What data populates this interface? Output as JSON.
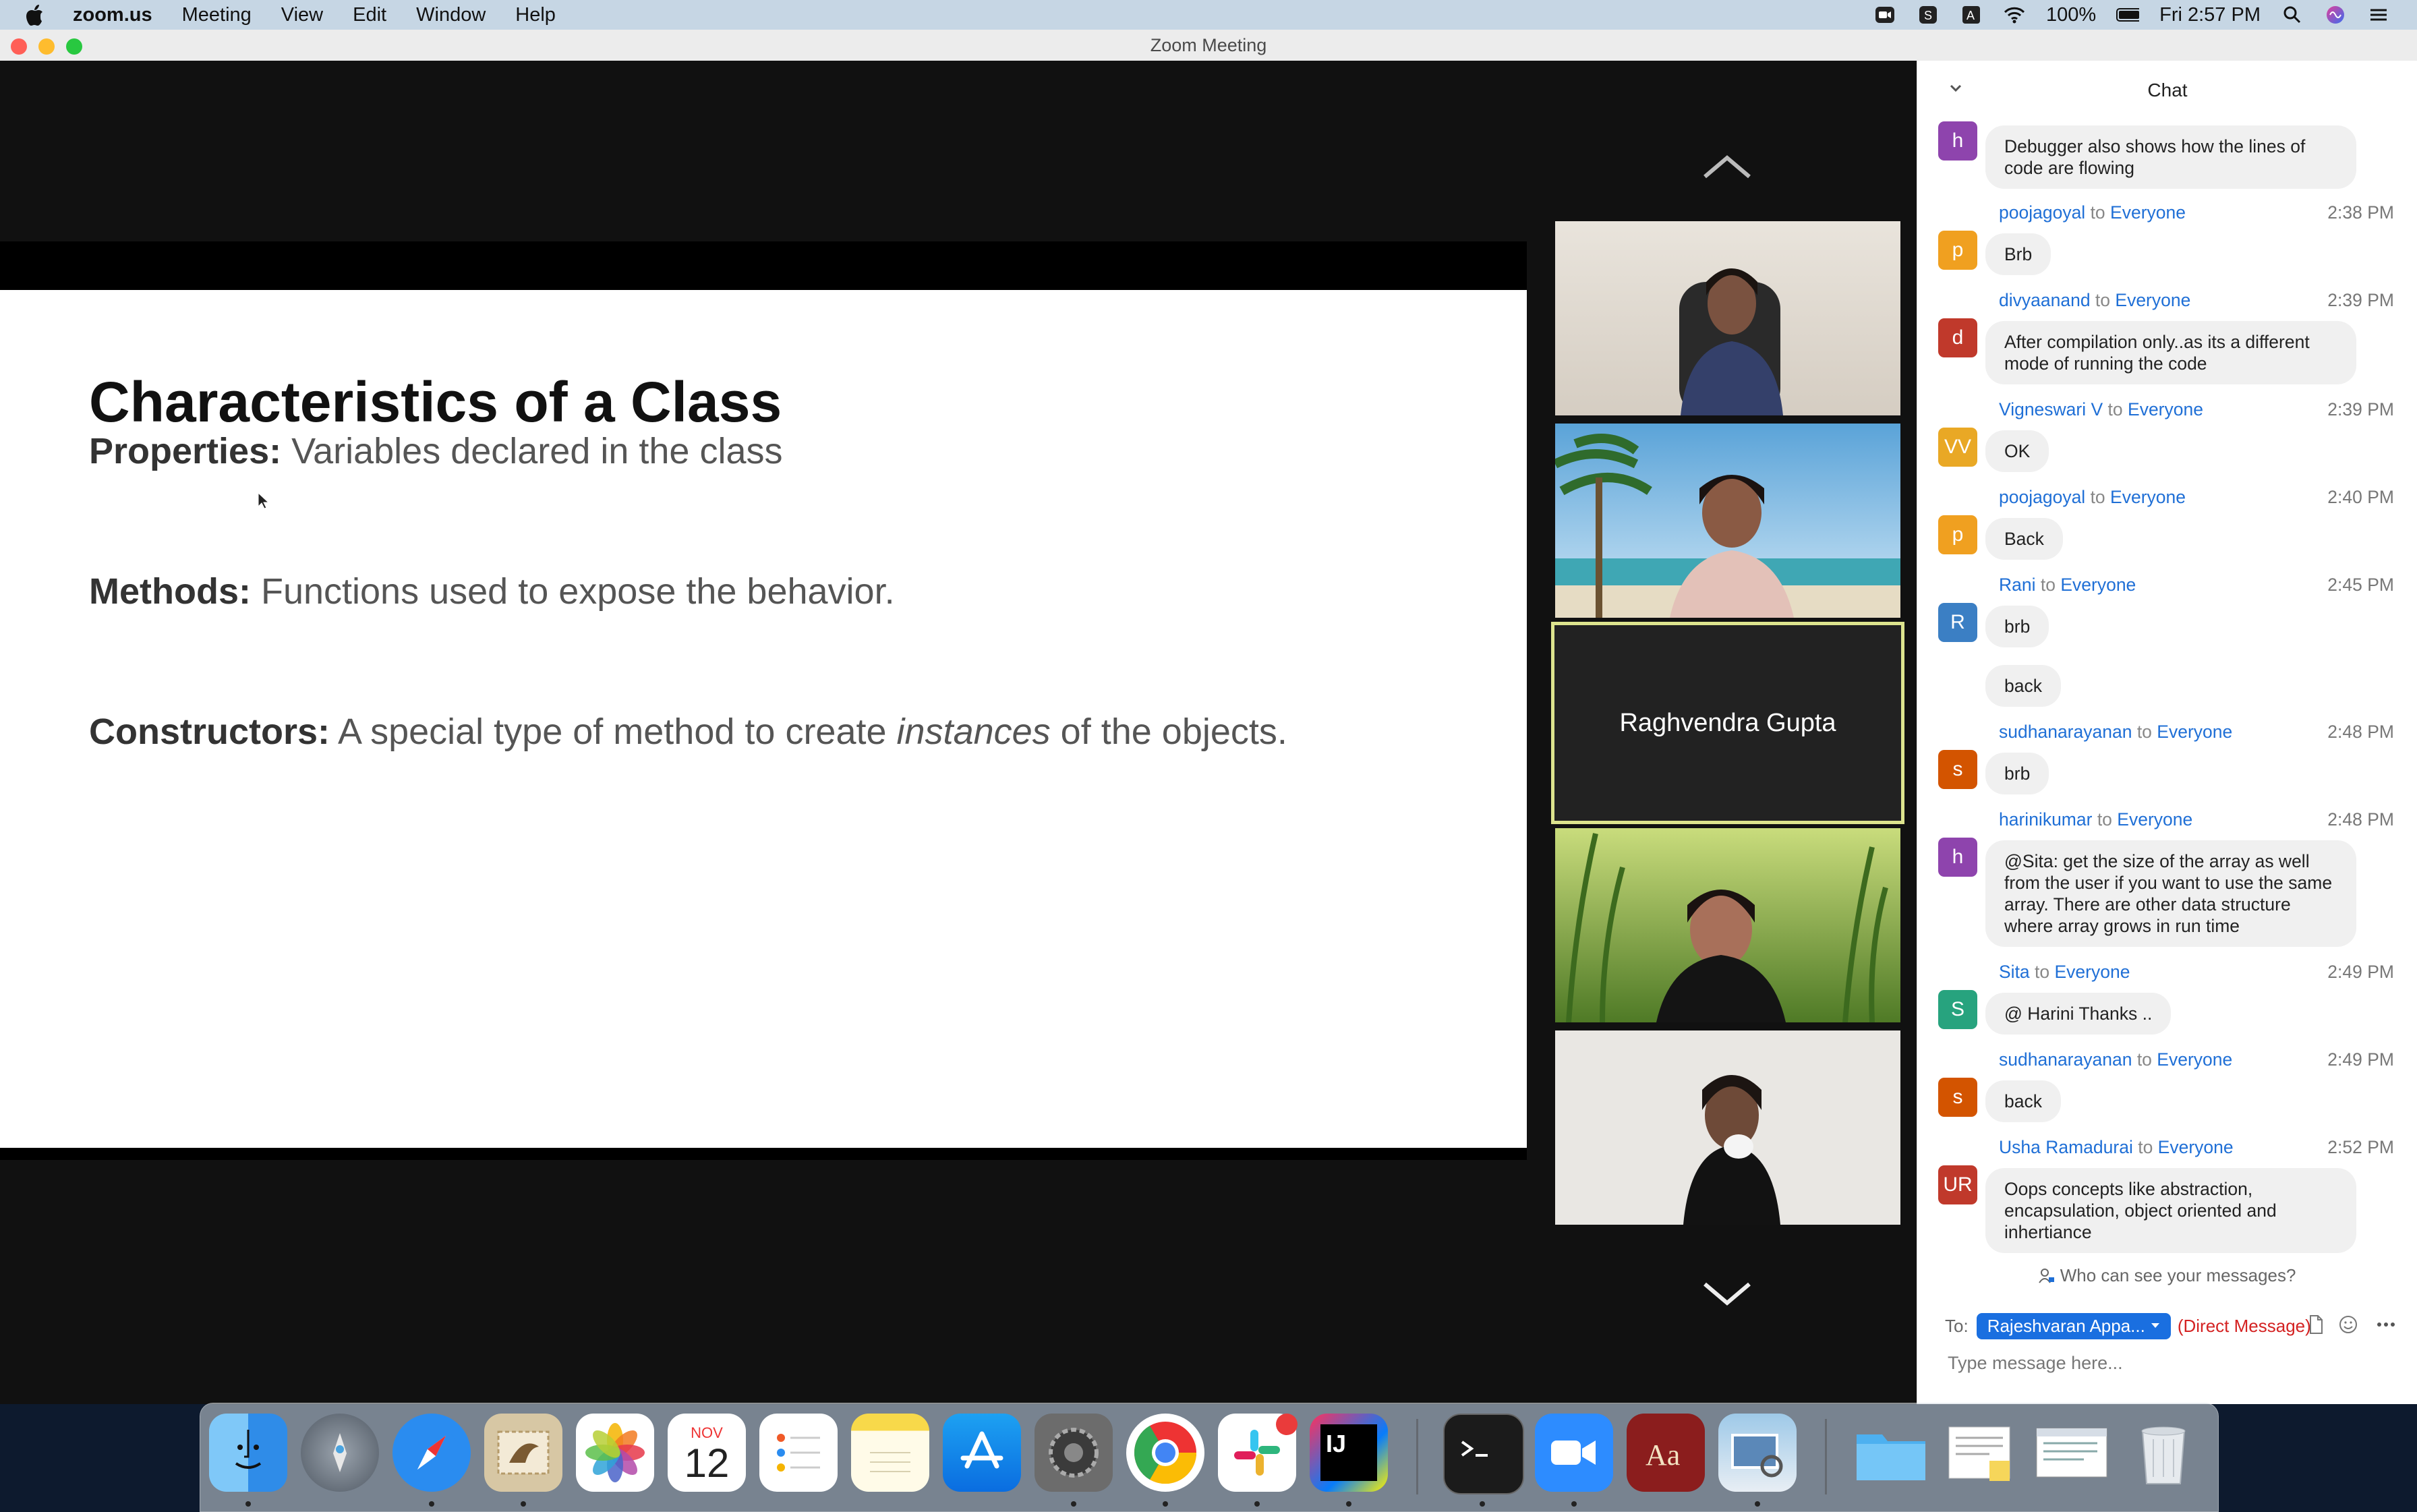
{
  "menubar": {
    "app_name": "zoom.us",
    "items": [
      "Meeting",
      "View",
      "Edit",
      "Window",
      "Help"
    ],
    "battery": "100%",
    "clock": "Fri 2:57 PM"
  },
  "window": {
    "title": "Zoom Meeting"
  },
  "slide": {
    "title": "Characteristics of a Class",
    "lines": [
      {
        "term": "Properties:",
        "text": " Variables declared in the class"
      },
      {
        "term": "Methods:",
        "text": " Functions used to expose the behavior."
      },
      {
        "term": "Constructors:",
        "text_before": " A special type of method to create ",
        "emphasis": "instances",
        "text_after": " of the objects."
      }
    ]
  },
  "gallery": {
    "name_tile": "Raghvendra Gupta"
  },
  "chat": {
    "title": "Chat",
    "messages": [
      {
        "initial": "h",
        "color": "#8e44ad",
        "sender": "",
        "to": "",
        "time": "",
        "text": "Debugger also shows how the lines of code are flowing"
      },
      {
        "initial": "p",
        "color": "#f0a020",
        "sender": "poojagoyal",
        "to": "Everyone",
        "time": "2:38 PM",
        "text": "Brb"
      },
      {
        "initial": "d",
        "color": "#c0392b",
        "sender": "divyaanand",
        "to": "Everyone",
        "time": "2:39 PM",
        "text": "After compilation only..as its a different mode of running the code"
      },
      {
        "initial": "VV",
        "color": "#e9a825",
        "sender": "Vigneswari V",
        "to": "Everyone",
        "time": "2:39 PM",
        "text": "OK"
      },
      {
        "initial": "p",
        "color": "#f0a020",
        "sender": "poojagoyal",
        "to": "Everyone",
        "time": "2:40 PM",
        "text": "Back"
      },
      {
        "initial": "R",
        "color": "#3b7fc4",
        "sender": "Rani",
        "to": "Everyone",
        "time": "2:45 PM",
        "text": "brb"
      },
      {
        "initial": "",
        "color": "",
        "sender": "",
        "to": "",
        "time": "",
        "text": "back"
      },
      {
        "initial": "s",
        "color": "#d35400",
        "sender": "sudhanarayanan",
        "to": "Everyone",
        "time": "2:48 PM",
        "text": "brb"
      },
      {
        "initial": "h",
        "color": "#8e44ad",
        "sender": "harinikumar",
        "to": "Everyone",
        "time": "2:48 PM",
        "text": "@Sita: get the size of the array as well from the user if you want to use the same array. There are other data structure where array grows in run time"
      },
      {
        "initial": "S",
        "color": "#27a37e",
        "sender": "Sita",
        "to": "Everyone",
        "time": "2:49 PM",
        "text": "@ Harini Thanks .."
      },
      {
        "initial": "s",
        "color": "#d35400",
        "sender": "sudhanarayanan",
        "to": "Everyone",
        "time": "2:49 PM",
        "text": "back"
      },
      {
        "initial": "UR",
        "color": "#c0392b",
        "sender": "Usha Ramadurai",
        "to": "Everyone",
        "time": "2:52 PM",
        "text": "Oops concepts like abstraction, encapsulation, object oriented and inhertiance"
      }
    ],
    "to_word": " to ",
    "who_can_see": "Who can see your messages?",
    "to_label": "To:",
    "recipient": "Rajeshvaran Appa...",
    "direct_message": "(Direct Message)",
    "input_placeholder": "Type message here..."
  },
  "dock": {
    "calendar_month": "NOV",
    "calendar_day": "12",
    "intellij_label": "IJ",
    "slack_badge": ""
  }
}
